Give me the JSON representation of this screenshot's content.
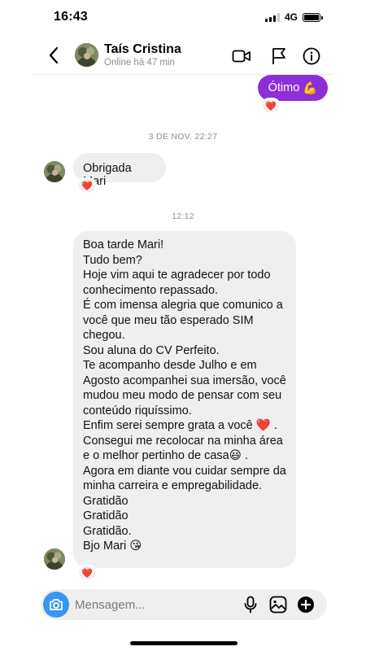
{
  "status_bar": {
    "time": "16:43",
    "network": "4G",
    "battery_level": 1.0
  },
  "header": {
    "contact_name": "Taís Cristina",
    "contact_status": "Online há 47 min",
    "icons": {
      "back": "chevron-left-icon",
      "video": "video-call-icon",
      "flag": "flag-icon",
      "info": "info-icon"
    }
  },
  "messages": {
    "outgoing": {
      "text": "Ótimo",
      "emoji": "💪",
      "reaction": "❤️"
    },
    "timestamp_1": "3 DE NOV. 22:27",
    "incoming_1": {
      "text": "Obrigada Mari",
      "reaction": "❤️"
    },
    "timestamp_2": "12:12",
    "incoming_2": {
      "lines": [
        "Boa tarde Mari!",
        "Tudo bem?",
        "Hoje vim aqui te agradecer por todo",
        "conhecimento repassado.",
        "É com imensa alegria que comunico a",
        "você que meu tão esperado SIM",
        "chegou.",
        "Sou aluna do CV Perfeito.",
        "Te acompanho desde Julho e em",
        "Agosto acompanhei sua imersão, você",
        "mudou meu modo de pensar com seu",
        "conteúdo riquíssimo.",
        "Enfim serei sempre grata a você ❤️ .",
        "Consegui me recolocar na minha área",
        "e o melhor pertinho de casa😃 .",
        "Agora em diante vou cuidar sempre da",
        "minha carreira e empregabilidade.",
        "Gratidão",
        "Gratidão",
        "Gratidão.",
        "Bjo Mari 😘"
      ],
      "reaction": "❤️"
    }
  },
  "composer": {
    "placeholder": "Mensagem...",
    "icons": {
      "camera": "camera-icon",
      "mic": "microphone-icon",
      "gallery": "gallery-icon",
      "add": "plus-icon"
    }
  },
  "colors": {
    "outgoing_bubble": "#8d2fd8",
    "incoming_bubble": "#efefef",
    "camera_button": "#3797f0"
  }
}
